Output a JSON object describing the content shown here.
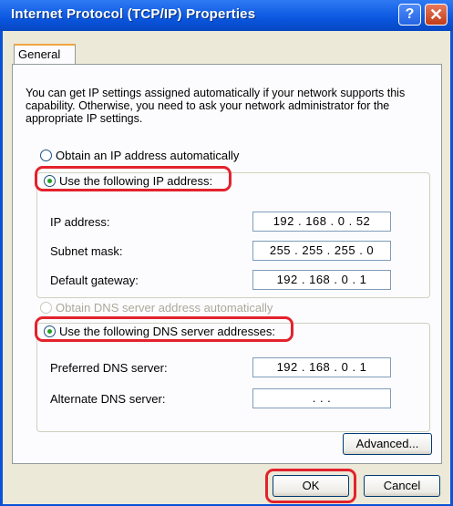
{
  "window": {
    "title": "Internet Protocol (TCP/IP) Properties",
    "help_label": "?",
    "close_label": "✕"
  },
  "tabs": [
    {
      "label": "General"
    }
  ],
  "description": "You can get IP settings assigned automatically if your network supports this capability. Otherwise, you need to ask your network administrator for the appropriate IP settings.",
  "ip_options": {
    "auto": {
      "label": "Obtain an IP address automatically",
      "checked": false
    },
    "manual": {
      "label": "Use the following IP address:",
      "checked": true
    }
  },
  "ip_fields": [
    {
      "label": "IP address:",
      "value": "192 . 168 .  0  .  52"
    },
    {
      "label": "Subnet mask:",
      "value": "255 . 255 . 255 .  0"
    },
    {
      "label": "Default gateway:",
      "value": "192 . 168 .  0  .  1"
    }
  ],
  "dns_options": {
    "auto": {
      "label": "Obtain DNS server address automatically",
      "checked": false,
      "disabled": true
    },
    "manual": {
      "label": "Use the following DNS server addresses:",
      "checked": true
    }
  },
  "dns_fields": [
    {
      "label": "Preferred DNS server:",
      "value": "192 . 168 .  0  .  1"
    },
    {
      "label": "Alternate DNS server:",
      "value": ".        .        ."
    }
  ],
  "buttons": {
    "advanced": "Advanced...",
    "ok": "OK",
    "cancel": "Cancel"
  },
  "colors": {
    "highlight": "#e3222d",
    "titlebar": "#0a56df",
    "dialog": "#ece9d8"
  }
}
